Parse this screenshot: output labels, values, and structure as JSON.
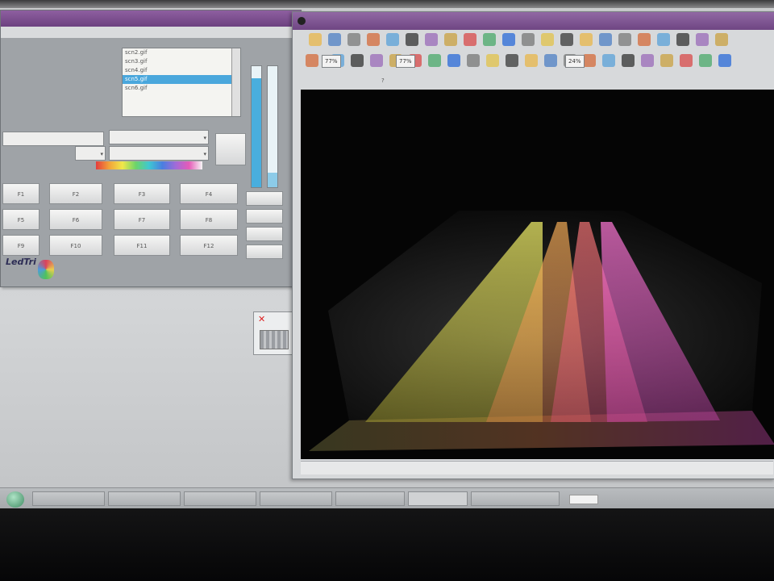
{
  "control_window": {
    "title": "",
    "files": [
      "scn2.gif",
      "scn3.gif",
      "scn4.gif",
      "scn5.gif",
      "scn6.gif"
    ],
    "selected_index": 3,
    "slider_label": "",
    "slider_levels": [
      0.9,
      0.12
    ],
    "combo1": "",
    "combo2": "",
    "combo3": "",
    "combo4": "",
    "buttons": [
      "F1",
      "F2",
      "F3",
      "F4",
      "F5",
      "F6",
      "F7",
      "F8",
      "F9",
      "F10",
      "F11",
      "F12"
    ],
    "side_buttons": [
      "",
      "",
      "",
      ""
    ],
    "logo_text": "LedTri"
  },
  "viewer_window": {
    "title": "",
    "zoom_values": [
      "77%",
      "77%",
      "24%"
    ],
    "menu": [
      "",
      "",
      "",
      "",
      "",
      "?"
    ]
  },
  "taskbar": {
    "buttons": [
      "",
      "",
      "",
      "",
      "",
      "",
      ""
    ]
  },
  "colors": {
    "title_bar": "#7a4f8e",
    "selection": "#4aa7dc",
    "scene_bg": "#050505"
  }
}
